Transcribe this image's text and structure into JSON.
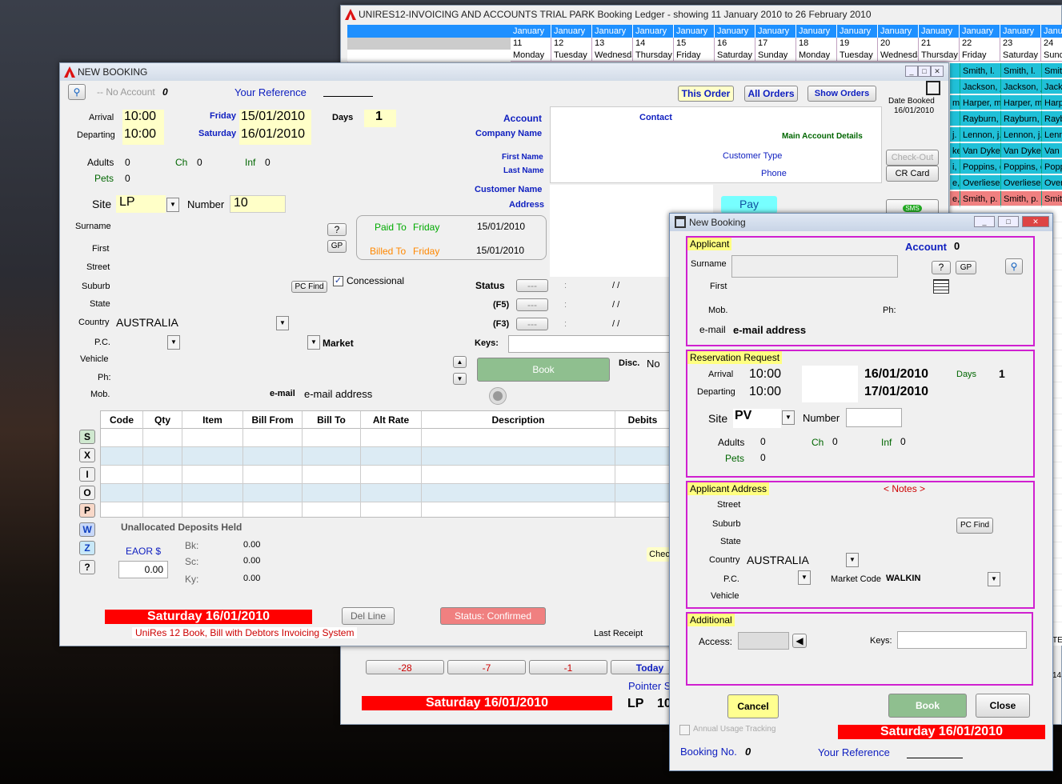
{
  "ledger": {
    "title": "UNIRES12-INVOICING AND ACCOUNTS TRIAL PARK Booking Ledger - showing 11 January 2010  to  26 February 2010",
    "columns": [
      {
        "month": "January",
        "day": "11",
        "weekday": "Monday"
      },
      {
        "month": "January",
        "day": "12",
        "weekday": "Tuesday"
      },
      {
        "month": "January",
        "day": "13",
        "weekday": "Wednesda"
      },
      {
        "month": "January",
        "day": "14",
        "weekday": "Thursday"
      },
      {
        "month": "January",
        "day": "15",
        "weekday": "Friday"
      },
      {
        "month": "January",
        "day": "16",
        "weekday": "Saturday"
      },
      {
        "month": "January",
        "day": "17",
        "weekday": "Sunday"
      },
      {
        "month": "January",
        "day": "18",
        "weekday": "Monday"
      },
      {
        "month": "January",
        "day": "19",
        "weekday": "Tuesday"
      },
      {
        "month": "January",
        "day": "20",
        "weekday": "Wednesda"
      },
      {
        "month": "January",
        "day": "21",
        "weekday": "Thursday"
      },
      {
        "month": "January",
        "day": "22",
        "weekday": "Friday"
      },
      {
        "month": "January",
        "day": "23",
        "weekday": "Saturday"
      },
      {
        "month": "January",
        "day": "24",
        "weekday": "Sund"
      }
    ],
    "row_col22": [
      "Smith, l.",
      "Jackson, j",
      "Harper, m",
      "Rayburn,",
      "Lennon, j.",
      "Van Dyke",
      "Poppins, c",
      "Overliese,",
      "Smith, p."
    ],
    "row_col23": [
      "Smith, l.",
      "Jackson, j",
      "Harper, m",
      "Rayburn,",
      "Lennon, j.",
      "Van Dyke",
      "Poppins, c",
      "Overliese,",
      "Smith, p."
    ],
    "row_col24": [
      "Smith",
      "Jacks",
      "Harpe",
      "Raybu",
      "Lenno",
      "Van D",
      "Popp",
      "Over",
      "Smith"
    ],
    "row_col21": [
      "",
      "",
      "m",
      "",
      "j.",
      "ke",
      "i, c",
      "e,",
      "e,"
    ],
    "nav": {
      "b1": "-28",
      "b2": "-7",
      "b3": "-1",
      "today": "Today"
    },
    "pointer": "Pointer S",
    "date_bar": "Saturday 16/01/2010",
    "site": "LP",
    "site_num": "10",
    "stub1": "TE",
    "stub2": "14"
  },
  "booking": {
    "title": "NEW BOOKING",
    "no_account": "-- No Account",
    "no_account_num": "0",
    "your_ref": "Your Reference",
    "this_order": "This Order",
    "all_orders": "All Orders",
    "show_orders": "Show Orders",
    "date_booked_lbl": "Date Booked",
    "date_booked": "16/01/2010",
    "arrival_lbl": "Arrival",
    "arrival_time": "10:00",
    "departing_lbl": "Departing",
    "departing_time": "10:00",
    "arr_day": "Friday",
    "arr_date": "15/01/2010",
    "dep_day": "Saturday",
    "dep_date": "16/01/2010",
    "days_lbl": "Days",
    "days": "1",
    "account_lbl": "Account",
    "company_lbl": "Company Name",
    "first_name_lbl": "First Name",
    "last_name_lbl": "Last Name",
    "customer_name_lbl": "Customer Name",
    "address_lbl": "Address",
    "contact_lbl": "Contact",
    "main_account_lbl": "Main Account Details",
    "customer_type_lbl": "Customer Type",
    "phone_lbl": "Phone",
    "checkout": "Check-Out",
    "cr_card": "CR Card",
    "pay": "Pay",
    "sms": "SMS",
    "adults_lbl": "Adults",
    "adults": "0",
    "ch_lbl": "Ch",
    "ch": "0",
    "inf_lbl": "Inf",
    "inf": "0",
    "pets_lbl": "Pets",
    "pets": "0",
    "site_lbl": "Site",
    "site": "LP",
    "number_lbl": "Number",
    "number": "10",
    "surname_lbl": "Surname",
    "first_lbl": "First",
    "street_lbl": "Street",
    "suburb_lbl": "Suburb",
    "state_lbl": "State",
    "country_lbl": "Country",
    "country": "AUSTRALIA",
    "pc_lbl": "P.C.",
    "vehicle_lbl": "Vehicle",
    "ph_lbl": "Ph:",
    "mob_lbl": "Mob.",
    "email_lbl": "e-mail",
    "email": "e-mail address",
    "q_btn": "?",
    "gp_btn": "GP",
    "pcfind_btn": "PC Find",
    "concessional": "Concessional",
    "market_lbl": "Market",
    "paid_to_lbl": "Paid To",
    "paid_to_day": "Friday",
    "paid_to_date": "15/01/2010",
    "billed_to_lbl": "Billed To",
    "billed_to_day": "Friday",
    "billed_to_date": "15/01/2010",
    "status_lbl": "Status",
    "f5_lbl": "(F5)",
    "f3_lbl": "(F3)",
    "dash": "---",
    "colon": ":",
    "slashes": "/ /",
    "keys_lbl": "Keys:",
    "book_btn": "Book",
    "disc_lbl": "Disc.",
    "disc": "No",
    "grid_headers": [
      "Code",
      "Qty",
      "Item",
      "Bill From",
      "Bill To",
      "Alt Rate",
      "Description",
      "Debits"
    ],
    "side_buttons": [
      "S",
      "X",
      "I",
      "O",
      "P",
      "W",
      "Z",
      "?"
    ],
    "unalloc_lbl": "Unallocated Deposits Held",
    "eaor_lbl": "EAOR $",
    "eaor": "0.00",
    "bk_lbl": "Bk:",
    "bk": "0.00",
    "sc_lbl": "Sc:",
    "sc": "0.00",
    "ky_lbl": "Ky:",
    "ky": "0.00",
    "chec": "Chec",
    "date_bar": "Saturday 16/01/2010",
    "del_line": "Del Line",
    "status_confirmed": "Status: Confirmed",
    "footer": "UniRes 12 Book, Bill with Debtors Invoicing System",
    "last_receipt": "Last Receipt"
  },
  "dialog": {
    "title": "New Booking",
    "applicant_lbl": "Applicant",
    "account_lbl": "Account",
    "account": "0",
    "surname_lbl": "Surname",
    "first_lbl": "First",
    "mob_lbl": "Mob.",
    "ph_lbl": "Ph:",
    "email_lbl": "e-mail",
    "email": "e-mail address",
    "q_btn": "?",
    "gp_btn": "GP",
    "resv_lbl": "Reservation Request",
    "arrival_lbl": "Arrival",
    "arrival_time": "10:00",
    "departing_lbl": "Departing",
    "departing_time": "10:00",
    "arr_date": "16/01/2010",
    "dep_date": "17/01/2010",
    "days_lbl": "Days",
    "days": "1",
    "site_lbl": "Site",
    "site": "PV",
    "number_lbl": "Number",
    "adults_lbl": "Adults",
    "adults": "0",
    "ch_lbl": "Ch",
    "ch": "0",
    "inf_lbl": "Inf",
    "inf": "0",
    "pets_lbl": "Pets",
    "pets": "0",
    "addr_lbl": "Applicant Address",
    "notes_lbl": "< Notes >",
    "street_lbl": "Street",
    "suburb_lbl": "Suburb",
    "state_lbl": "State",
    "pcfind_btn": "PC Find",
    "country_lbl": "Country",
    "country": "AUSTRALIA",
    "pc_lbl": "P.C.",
    "market_code_lbl": "Market Code",
    "market_code": "WALKIN",
    "vehicle_lbl": "Vehicle",
    "additional_lbl": "Additional",
    "access_lbl": "Access:",
    "keys_lbl": "Keys:",
    "cancel_btn": "Cancel",
    "book_btn": "Book",
    "close_btn": "Close",
    "annual_usage": "Annual Usage Tracking",
    "date_bar": "Saturday 16/01/2010",
    "booking_no_lbl": "Booking No.",
    "booking_no": "0",
    "your_ref": "Your Reference"
  },
  "colors": {
    "accent_blue": "#1020c0",
    "calendar_cyan": "#20c0d8",
    "status_red": "#ff0000",
    "highlight_yellow": "#ffffc8",
    "section_magenta": "#d020d0"
  }
}
